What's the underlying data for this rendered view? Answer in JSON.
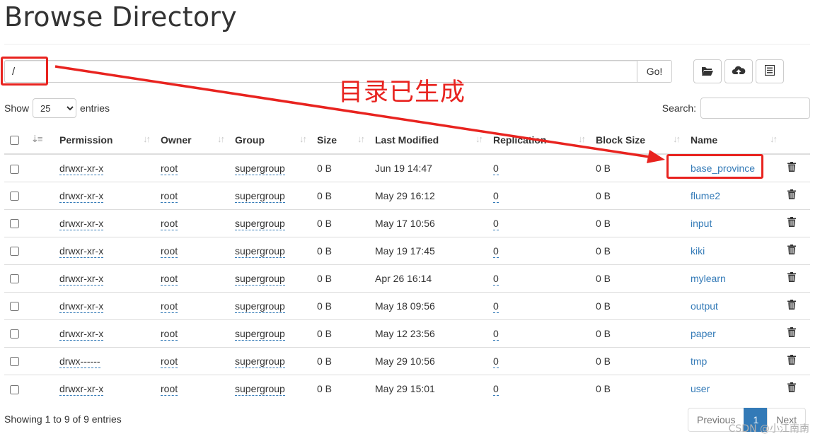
{
  "page": {
    "title": "Browse Directory"
  },
  "path": {
    "value": "/",
    "go_label": "Go!"
  },
  "toolbar": {
    "icons": [
      "folder-open-icon",
      "cloud-upload-icon",
      "list-icon"
    ]
  },
  "length": {
    "show_label": "Show",
    "selected": "25",
    "entries_label": "entries"
  },
  "search": {
    "label": "Search:",
    "value": ""
  },
  "table": {
    "columns": [
      "Permission",
      "Owner",
      "Group",
      "Size",
      "Last Modified",
      "Replication",
      "Block Size",
      "Name"
    ],
    "rows": [
      {
        "permission": "drwxr-xr-x",
        "owner": "root",
        "group": "supergroup",
        "size": "0 B",
        "modified": "Jun 19 14:47",
        "replication": "0",
        "block_size": "0 B",
        "name": "base_province"
      },
      {
        "permission": "drwxr-xr-x",
        "owner": "root",
        "group": "supergroup",
        "size": "0 B",
        "modified": "May 29 16:12",
        "replication": "0",
        "block_size": "0 B",
        "name": "flume2"
      },
      {
        "permission": "drwxr-xr-x",
        "owner": "root",
        "group": "supergroup",
        "size": "0 B",
        "modified": "May 17 10:56",
        "replication": "0",
        "block_size": "0 B",
        "name": "input"
      },
      {
        "permission": "drwxr-xr-x",
        "owner": "root",
        "group": "supergroup",
        "size": "0 B",
        "modified": "May 19 17:45",
        "replication": "0",
        "block_size": "0 B",
        "name": "kiki"
      },
      {
        "permission": "drwxr-xr-x",
        "owner": "root",
        "group": "supergroup",
        "size": "0 B",
        "modified": "Apr 26 16:14",
        "replication": "0",
        "block_size": "0 B",
        "name": "mylearn"
      },
      {
        "permission": "drwxr-xr-x",
        "owner": "root",
        "group": "supergroup",
        "size": "0 B",
        "modified": "May 18 09:56",
        "replication": "0",
        "block_size": "0 B",
        "name": "output"
      },
      {
        "permission": "drwxr-xr-x",
        "owner": "root",
        "group": "supergroup",
        "size": "0 B",
        "modified": "May 12 23:56",
        "replication": "0",
        "block_size": "0 B",
        "name": "paper"
      },
      {
        "permission": "drwx------",
        "owner": "root",
        "group": "supergroup",
        "size": "0 B",
        "modified": "May 29 10:56",
        "replication": "0",
        "block_size": "0 B",
        "name": "tmp"
      },
      {
        "permission": "drwxr-xr-x",
        "owner": "root",
        "group": "supergroup",
        "size": "0 B",
        "modified": "May 29 15:01",
        "replication": "0",
        "block_size": "0 B",
        "name": "user"
      }
    ]
  },
  "footer": {
    "info": "Showing 1 to 9 of 9 entries",
    "previous": "Previous",
    "current_page": "1",
    "next": "Next"
  },
  "annotation": {
    "text": "目录已生成",
    "color": "#e8231f"
  },
  "watermark": "CSDN @小江南南",
  "colors": {
    "link": "#337ab7",
    "border": "#dddddd",
    "annotation": "#e8231f",
    "pager_active": "#337ab7"
  }
}
